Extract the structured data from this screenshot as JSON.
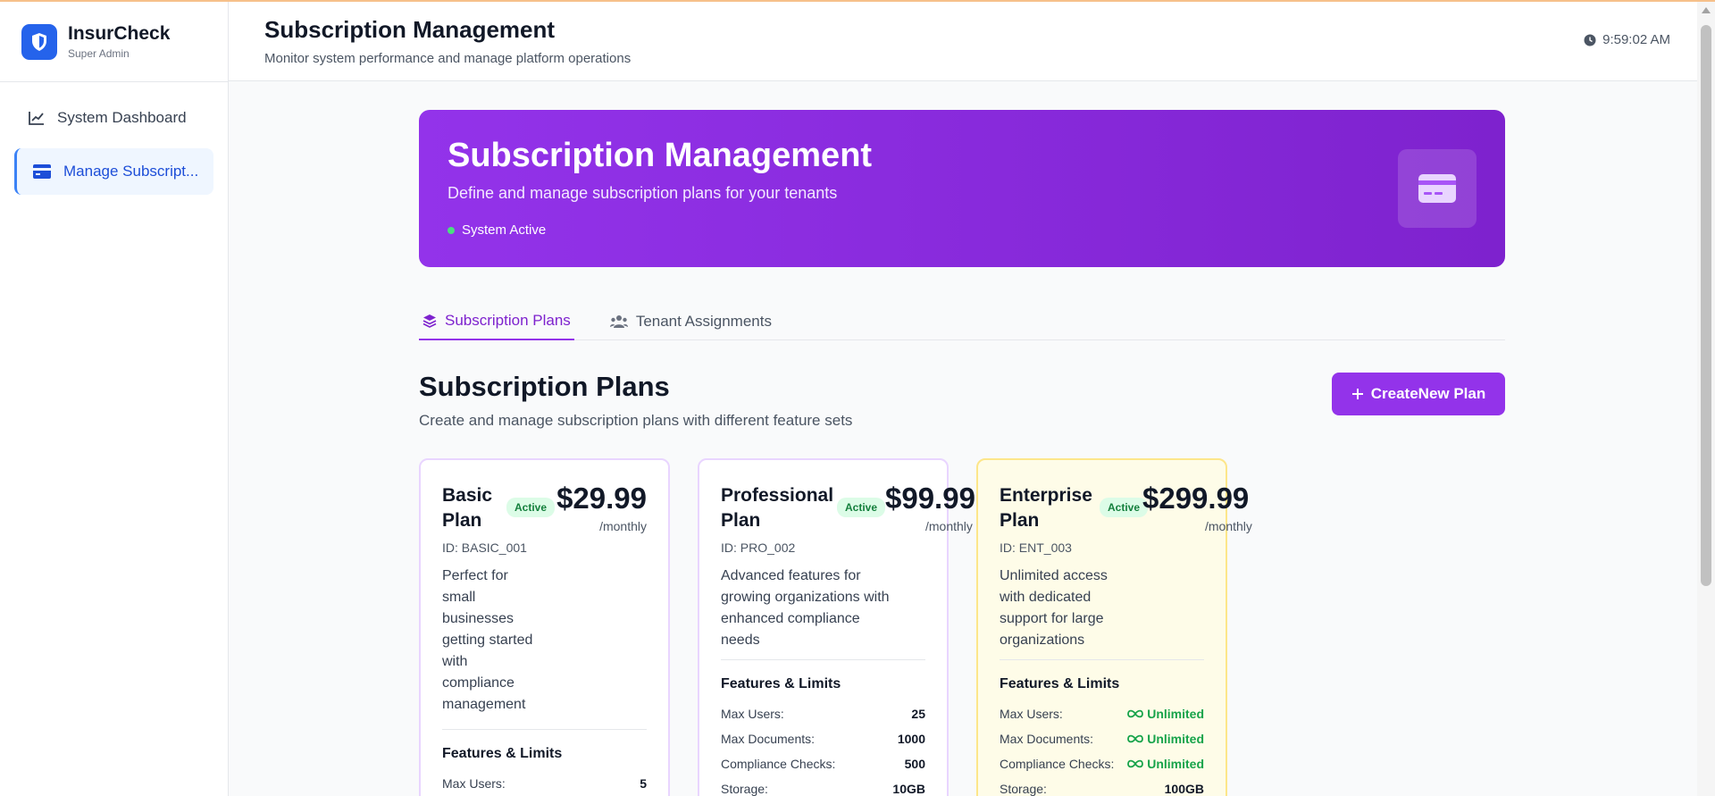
{
  "brand": {
    "name": "InsurCheck",
    "role": "Super Admin"
  },
  "sidebar": {
    "items": [
      {
        "label": "System Dashboard",
        "icon": "chart-line-icon"
      },
      {
        "label": "Manage Subscript...",
        "icon": "credit-card-icon"
      }
    ]
  },
  "header": {
    "title": "Subscription Management",
    "subtitle": "Monitor system performance and manage platform operations",
    "time": "9:59:02 AM"
  },
  "hero": {
    "title": "Subscription Management",
    "subtitle": "Define and manage subscription plans for your tenants",
    "status": "System Active"
  },
  "tabs": [
    {
      "label": "Subscription Plans",
      "icon": "layers-icon"
    },
    {
      "label": "Tenant Assignments",
      "icon": "users-icon"
    }
  ],
  "section": {
    "title": "Subscription Plans",
    "subtitle": "Create and manage subscription plans with different feature sets",
    "create_label": "CreateNew Plan"
  },
  "plans": [
    {
      "name": "Basic Plan",
      "badge": "Active",
      "price": "$29.99",
      "period": "/monthly",
      "id": "ID: BASIC_001",
      "description": "Perfect for small businesses getting started with compliance management",
      "features_title": "Features & Limits",
      "features": [
        {
          "label": "Max Users:",
          "value": "5"
        }
      ]
    },
    {
      "name": "Professional Plan",
      "badge": "Active",
      "price": "$99.99",
      "period": "/monthly",
      "id": "ID: PRO_002",
      "description": "Advanced features for growing organizations with enhanced compliance needs",
      "features_title": "Features & Limits",
      "features": [
        {
          "label": "Max Users:",
          "value": "25"
        },
        {
          "label": "Max Documents:",
          "value": "1000"
        },
        {
          "label": "Compliance Checks:",
          "value": "500"
        },
        {
          "label": "Storage:",
          "value": "10GB"
        }
      ]
    },
    {
      "name": "Enterprise Plan",
      "badge": "Active",
      "price": "$299.99",
      "period": "/monthly",
      "id": "ID: ENT_003",
      "description": "Unlimited access with dedicated support for large organizations",
      "features_title": "Features & Limits",
      "features": [
        {
          "label": "Max Users:",
          "value": "Unlimited"
        },
        {
          "label": "Max Documents:",
          "value": "Unlimited"
        },
        {
          "label": "Compliance Checks:",
          "value": "Unlimited"
        },
        {
          "label": "Storage:",
          "value": "100GB"
        }
      ]
    }
  ],
  "colors": {
    "brand": "#2563eb",
    "accent": "#9333ea",
    "success": "#16a34a"
  }
}
